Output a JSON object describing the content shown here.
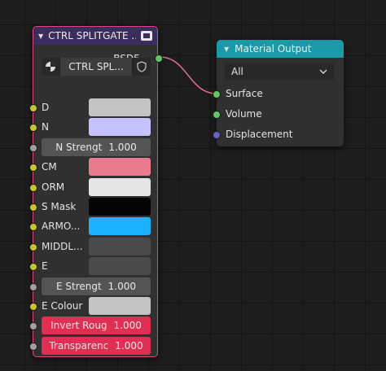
{
  "group_node": {
    "title": "CTRL SPLITGATE ...",
    "output_label": "BSDF",
    "datablock_name": "CTRL SPL...",
    "inputs": [
      {
        "label": "D",
        "type": "color",
        "color": "#c4c4c4",
        "socket": "yellow"
      },
      {
        "label": "N",
        "type": "color",
        "color": "#c6c2ff",
        "socket": "yellow"
      },
      {
        "label": "N Strengt",
        "type": "value",
        "value": "1.000",
        "socket": "gray"
      },
      {
        "label": "CM",
        "type": "color",
        "color": "#ea7a8e",
        "socket": "yellow"
      },
      {
        "label": "ORM",
        "type": "color",
        "color": "#e6e6e6",
        "socket": "yellow"
      },
      {
        "label": "S Mask",
        "type": "color",
        "color": "#050505",
        "socket": "yellow"
      },
      {
        "label": "ARMO...",
        "type": "color",
        "color": "#1cb2ff",
        "socket": "yellow"
      },
      {
        "label": "MIDDL...",
        "type": "color",
        "color": "#4a4a4a",
        "socket": "yellow"
      },
      {
        "label": "E",
        "type": "color",
        "color": "#4a4a4a",
        "socket": "yellow"
      },
      {
        "label": "E Strengt",
        "type": "value",
        "value": "1.000",
        "socket": "gray"
      },
      {
        "label": "E Colour",
        "type": "color",
        "color": "#c4c4c4",
        "socket": "yellow"
      },
      {
        "label": "Invert Roug",
        "type": "value_red",
        "value": "1.000",
        "socket": "gray"
      },
      {
        "label": "Transparenc",
        "type": "value_red",
        "value": "1.000",
        "socket": "gray"
      }
    ]
  },
  "material_output": {
    "title": "Material Output",
    "target": "All",
    "inputs": [
      {
        "label": "Surface",
        "socket": "green"
      },
      {
        "label": "Volume",
        "socket": "green"
      },
      {
        "label": "Displacement",
        "socket": "purple"
      }
    ]
  },
  "link_color": "#e06c8e"
}
